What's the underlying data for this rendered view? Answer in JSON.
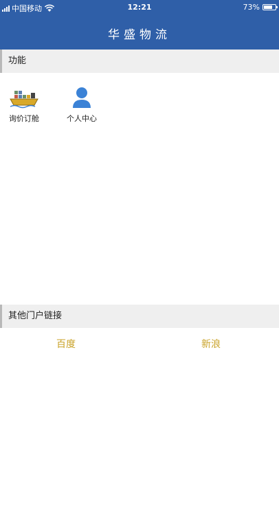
{
  "status_bar": {
    "carrier": "中国移动",
    "time": "12:21",
    "battery": "73%"
  },
  "nav": {
    "title": "华盛物流"
  },
  "sections": {
    "functions": "功能",
    "links": "其他门户链接"
  },
  "functions": [
    {
      "label": "询价订舱",
      "icon": "ship-icon"
    },
    {
      "label": "个人中心",
      "icon": "user-icon"
    }
  ],
  "links": [
    {
      "label": "百度"
    },
    {
      "label": "新浪"
    }
  ],
  "colors": {
    "header": "#2f5fa8",
    "section_bg": "#efefef",
    "link": "#c9a227",
    "user_icon": "#3b82d6",
    "ship_hull": "#d8a92a"
  }
}
